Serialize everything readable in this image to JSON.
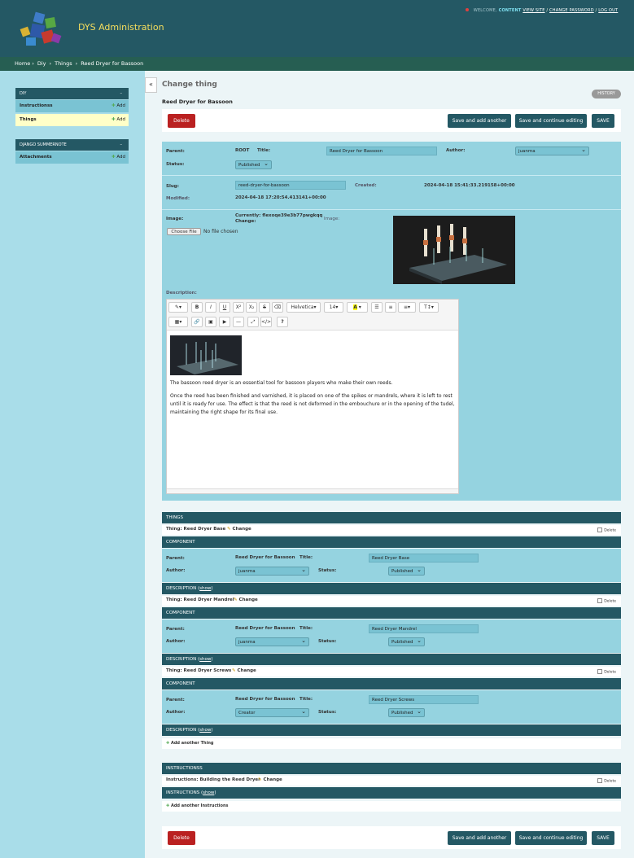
{
  "header": {
    "site_name": "DYS Administration",
    "welcome": "WELCOME,",
    "user": "CONTENT",
    "view_site": "VIEW SITE",
    "change_password": "CHANGE PASSWORD",
    "logout": "LOG OUT",
    "sep": "/"
  },
  "breadcrumb": [
    "Home",
    "Diy",
    "Things",
    "Reed Dryer for Bassoon"
  ],
  "breadcrumb_sep": "›",
  "sidebar": {
    "collapse": "«",
    "apps": [
      {
        "title": "DIY",
        "toggle": "–",
        "models": [
          {
            "name": "Instructionss",
            "add": "Add"
          },
          {
            "name": "Things",
            "add": "Add"
          }
        ]
      },
      {
        "title": "DJANGO SUMMERNOTE",
        "toggle": "–",
        "models": [
          {
            "name": "Attachments",
            "add": "Add"
          }
        ]
      }
    ]
  },
  "page": {
    "title": "Change thing",
    "object": "Reed Dryer for Bassoon",
    "history": "HISTORY"
  },
  "actions": {
    "delete": "Delete",
    "save_add": "Save and add another",
    "save_continue": "Save and continue editing",
    "save": "SAVE"
  },
  "form": {
    "parent_label": "Parent:",
    "parent_value": "ROOT",
    "title_label": "Title:",
    "title_value": "Reed Dryer for Bassoon",
    "author_label": "Author:",
    "author_value": "juanma",
    "status_label": "Status:",
    "status_value": "Published",
    "slug_label": "Slug:",
    "slug_value": "reed-dryer-for-bassoon",
    "created_label": "Created:",
    "created_value": "2024-04-18 15:41:33.219158+00:00",
    "modified_label": "Modified:",
    "modified_value": "2024-04-18 17:20:54.413141+00:00",
    "image_label": "Image:",
    "currently": "Currently: flexoqe39e3b77pwgkqq",
    "change": "Change:",
    "choose_file": "Choose File",
    "no_file": "No file chosen",
    "image_preview_label": "Image:",
    "description_label": "Description:"
  },
  "editor": {
    "font": "Helvetica",
    "size": "14",
    "para1": "The bassoon reed dryer is an essential tool for bassoon players who make their own reeds.",
    "para2": "Once the reed has been finished and varnished, it is placed on one of the spikes or mandrels, where it is left to rest until it is ready for use. The effect is that the reed is not deformed in the embouchure or in the opening of the tudel, maintaining the right shape for its final use.",
    "help": "?",
    "code": "</>"
  },
  "things_inline": {
    "title": "THINGS",
    "component": "COMPONENT",
    "delete": "Delete",
    "change": "Change",
    "description": "DESCRIPTION",
    "show": "show",
    "add_another": "Add another Thing",
    "items": [
      {
        "title": "Thing: Reed Dryer Base",
        "parent_label": "Parent:",
        "parent": "Reed Dryer for Bassoon",
        "title_label": "Title:",
        "name": "Reed Dryer Base",
        "author_label": "Author:",
        "author": "juanma",
        "status_label": "Status:",
        "status": "Published"
      },
      {
        "title": "Thing: Reed Dryer Mandrel",
        "parent_label": "Parent:",
        "parent": "Reed Dryer for Bassoon",
        "title_label": "Title:",
        "name": "Reed Dryer Mandrel",
        "author_label": "Author:",
        "author": "juanma",
        "status_label": "Status:",
        "status": "Published"
      },
      {
        "title": "Thing: Reed Dryer Screws",
        "parent_label": "Parent:",
        "parent": "Reed Dryer for Bassoon",
        "title_label": "Title:",
        "name": "Reed Dryer Screws",
        "author_label": "Author:",
        "author": "Creator",
        "status_label": "Status:",
        "status": "Published"
      }
    ]
  },
  "instr_inline": {
    "title": "INSTRUCTIONSS",
    "item": "Instructions: Building the Reed Dryer",
    "change": "Change",
    "delete": "Delete",
    "sub": "INSTRUCTIONS",
    "show": "show",
    "add_another": "Add another Instructions"
  },
  "colors": {
    "header": "#245864",
    "breadcrumb": "#265e52",
    "accent": "#7ac3d3",
    "danger": "#ba2121"
  }
}
